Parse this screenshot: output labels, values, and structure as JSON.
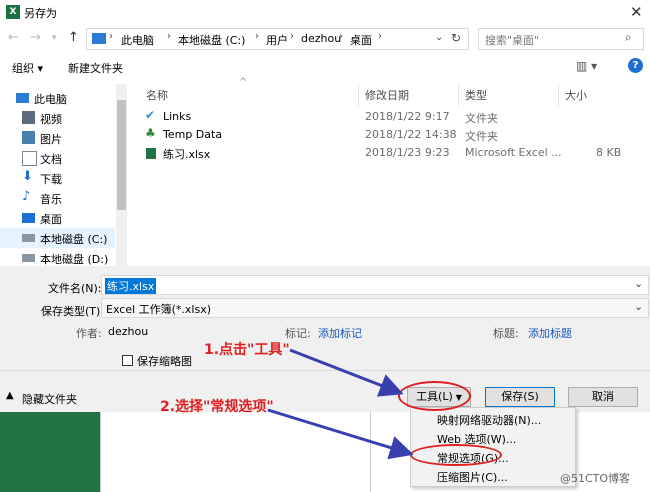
{
  "window": {
    "title": "另存为",
    "app_badge": "X"
  },
  "address": {
    "crumbs": [
      "此电脑",
      "本地磁盘 (C:)",
      "用户",
      "dezhou",
      "桌面"
    ],
    "search_placeholder": "搜索\"桌面\""
  },
  "toolbar": {
    "organize": "组织 ▾",
    "new_folder": "新建文件夹",
    "help": "?"
  },
  "nav": {
    "items": [
      {
        "label": "此电脑",
        "icon": "pc-icon"
      },
      {
        "label": "视频",
        "icon": "video-icon"
      },
      {
        "label": "图片",
        "icon": "pictures-icon"
      },
      {
        "label": "文档",
        "icon": "documents-icon"
      },
      {
        "label": "下载",
        "icon": "download-icon"
      },
      {
        "label": "音乐",
        "icon": "music-icon"
      },
      {
        "label": "桌面",
        "icon": "desktop-icon"
      },
      {
        "label": "本地磁盘 (C:)",
        "icon": "drive-icon"
      },
      {
        "label": "本地磁盘 (D:)",
        "icon": "drive-icon"
      }
    ]
  },
  "files": {
    "headers": [
      "名称",
      "修改日期",
      "类型",
      "大小"
    ],
    "rows": [
      {
        "name": "Links",
        "date": "2018/1/22 9:17",
        "type": "文件夹",
        "size": "",
        "icon": "links-folder-icon"
      },
      {
        "name": "Temp Data",
        "date": "2018/1/22 14:38",
        "type": "文件夹",
        "size": "",
        "icon": "tree-folder-icon"
      },
      {
        "name": "练习.xlsx",
        "date": "2018/1/23 9:23",
        "type": "Microsoft Excel ...",
        "size": "8 KB",
        "icon": "excel-file-icon"
      }
    ]
  },
  "form": {
    "filename_label": "文件名(N):",
    "filename_value": "练习.xlsx",
    "filetype_label": "保存类型(T):",
    "filetype_value": "Excel 工作簿(*.xlsx)",
    "author_label": "作者:",
    "author_value": "dezhou",
    "tags_label": "标记:",
    "tags_value": "添加标记",
    "title_label": "标题:",
    "title_value": "添加标题",
    "thumbnail_label": "保存缩略图"
  },
  "footer": {
    "hide_folders": "隐藏文件夹",
    "tools": "工具(L)",
    "save": "保存(S)",
    "cancel": "取消"
  },
  "menu": {
    "items": [
      "映射网络驱动器(N)...",
      "Web 选项(W)...",
      "常规选项(G)...",
      "压缩图片(C)..."
    ]
  },
  "annotations": {
    "step1": "1.点击\"工具\"",
    "step2": "2.选择\"常规选项\""
  },
  "watermark": "@51CTO博客",
  "colors": {
    "accent": "#0078d7",
    "annotation": "#e02020",
    "arrow": "#3a3fb0",
    "excel_green": "#217346"
  }
}
